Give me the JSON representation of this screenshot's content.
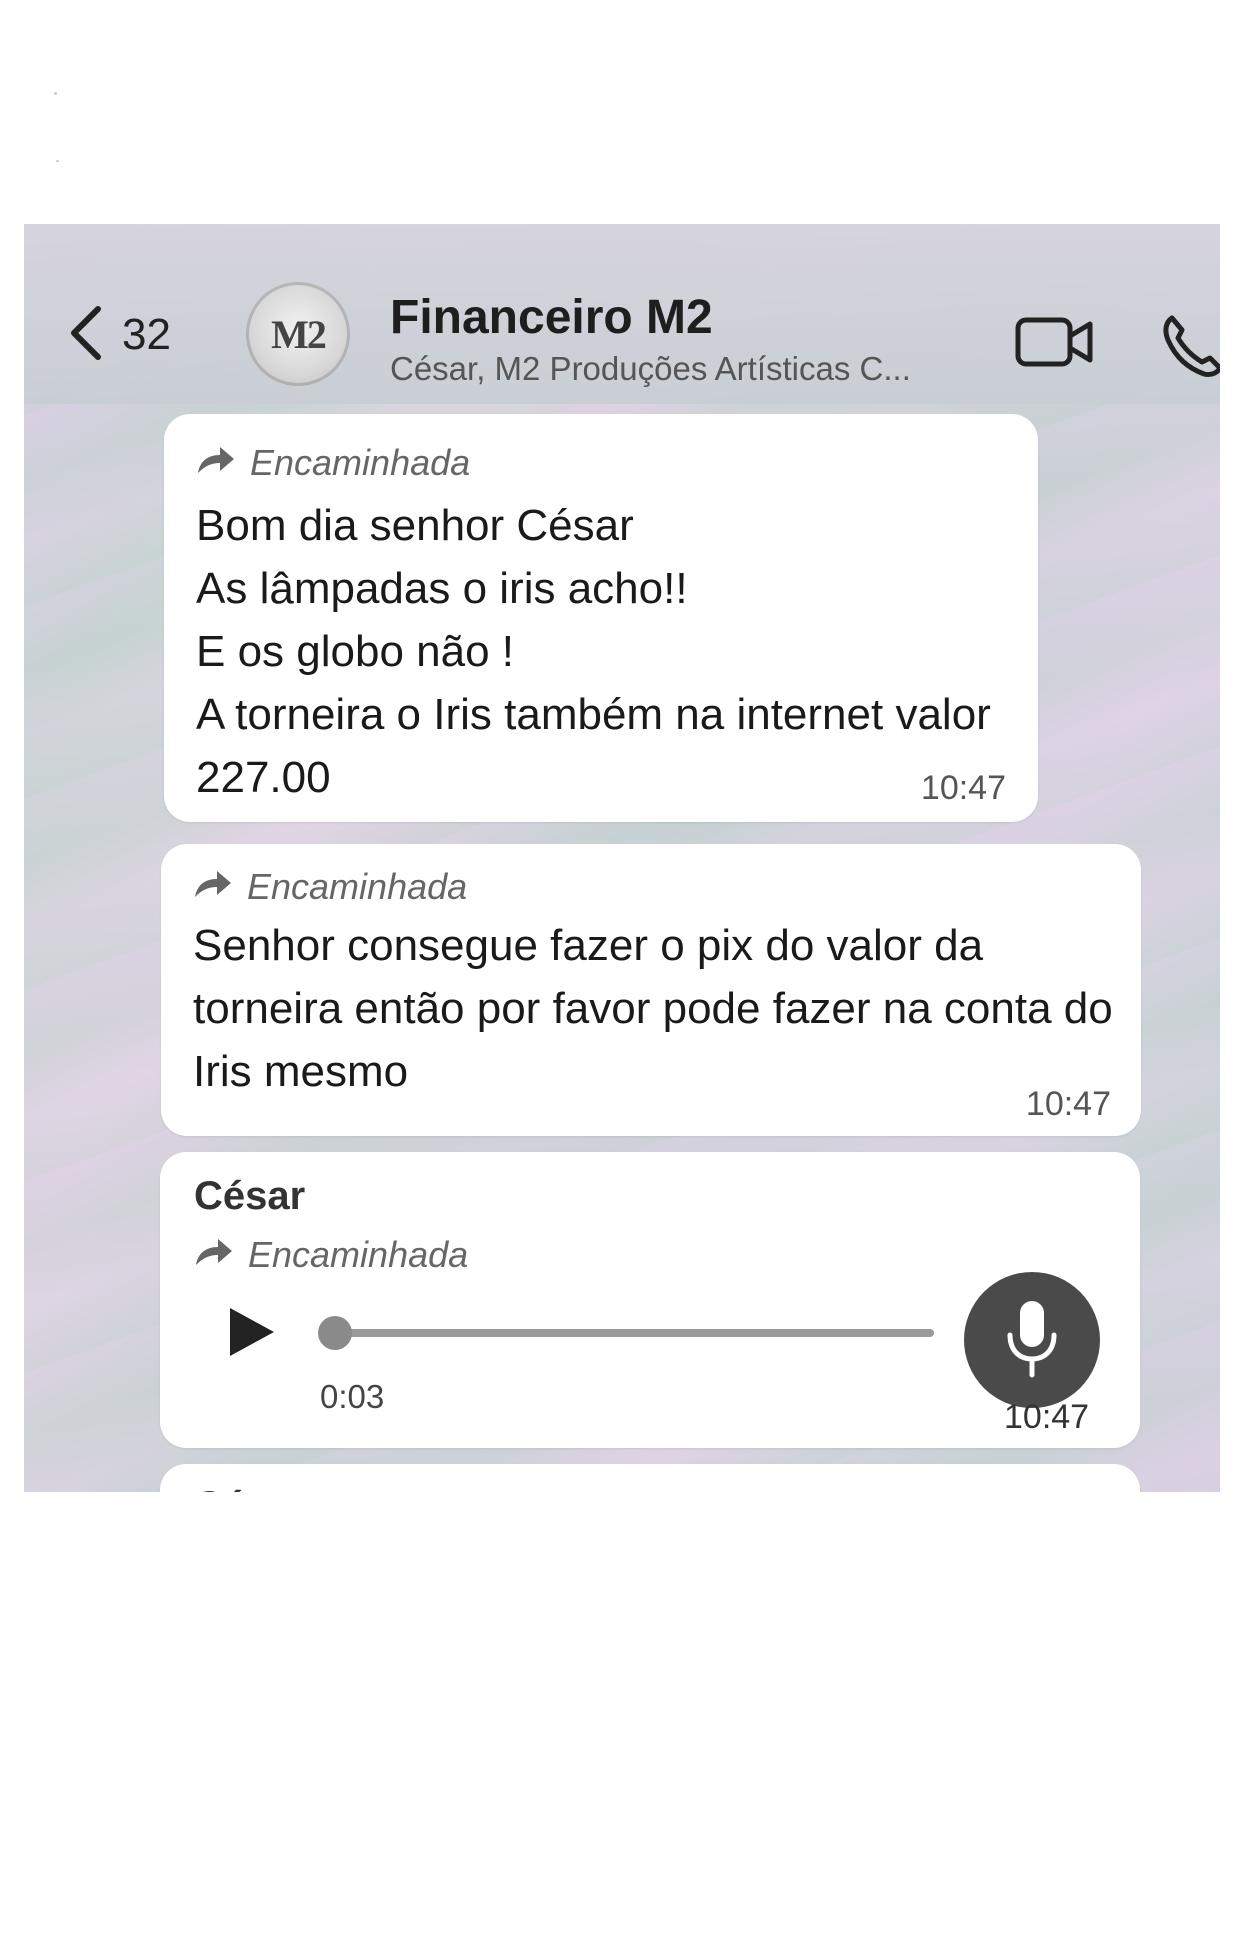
{
  "header": {
    "back_count": "32",
    "avatar_text": "M2",
    "title": "Financeiro M2",
    "subtitle": "César, M2 Produções Artísticas C..."
  },
  "messages": [
    {
      "forwarded_label": "Encaminhada",
      "text": "Bom dia senhor César\nAs lâmpadas o iris acho!!\nE os globo não !\nA torneira o Iris também na internet valor 227.00",
      "time": "10:47"
    },
    {
      "forwarded_label": "Encaminhada",
      "text": "Senhor consegue fazer o pix do valor da torneira então por favor pode fazer na conta do Iris mesmo",
      "time": "10:47"
    },
    {
      "sender": "César",
      "forwarded_label": "Encaminhada",
      "audio_duration": "0:03",
      "audio_progress": 0,
      "time": "10:47"
    },
    {
      "sender": "César"
    }
  ],
  "icons": {
    "back": "chevron-left-icon",
    "video": "video-camera-icon",
    "phone": "phone-icon",
    "forward": "forward-arrow-icon",
    "play": "play-icon",
    "mic": "microphone-icon"
  }
}
